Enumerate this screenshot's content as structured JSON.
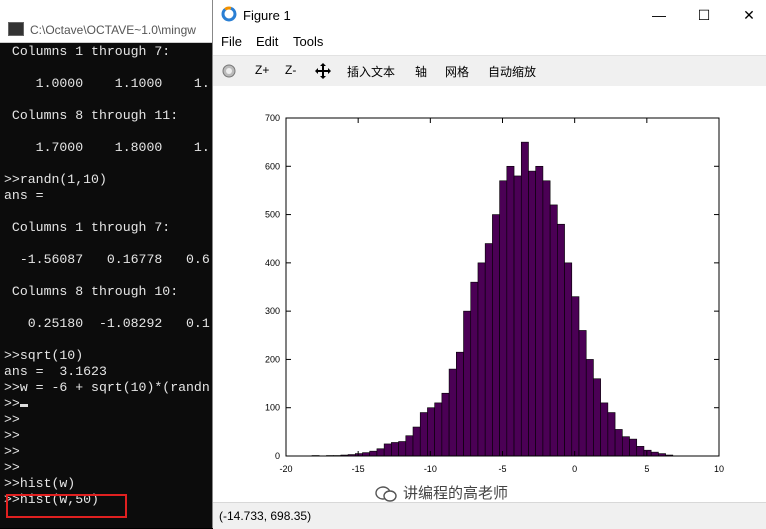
{
  "console": {
    "title": "C:\\Octave\\OCTAVE~1.0\\mingw",
    "lines": [
      " Columns 1 through 7:",
      "",
      "    1.0000    1.1000    1.",
      "",
      " Columns 8 through 11:",
      "",
      "    1.7000    1.8000    1.",
      "",
      ">>randn(1,10)",
      "ans =",
      "",
      " Columns 1 through 7:",
      "",
      "  -1.56087   0.16778   0.6",
      "",
      " Columns 8 through 10:",
      "",
      "   0.25180  -1.08292   0.1",
      "",
      ">>sqrt(10)",
      "ans =  3.1623",
      ">>w = -6 + sqrt(10)*(randn",
      ">>",
      ">>",
      ">>",
      ">>",
      ">>",
      ">>hist(w)",
      ">>hist(w,50)"
    ]
  },
  "figure": {
    "title": "Figure 1",
    "menu": [
      "File",
      "Edit",
      "Tools"
    ],
    "toolbar": {
      "zoom_in": "Z+",
      "zoom_out": "Z-",
      "insert_text": "插入文本",
      "axes": "轴",
      "grid": "网格",
      "autoscale": "自动缩放"
    },
    "window_buttons": {
      "minimize": "—",
      "maximize": "☐",
      "close": "✕"
    },
    "status_coords": "(-14.733, 698.35)"
  },
  "watermark": "讲编程的高老师",
  "chart_data": {
    "type": "bar",
    "title": "",
    "xlabel": "",
    "ylabel": "",
    "xlim": [
      -20,
      10
    ],
    "ylim": [
      0,
      700
    ],
    "xticks": [
      -20,
      -15,
      -10,
      -5,
      0,
      5,
      10
    ],
    "yticks": [
      0,
      100,
      200,
      300,
      400,
      500,
      600,
      700
    ],
    "grid": false,
    "bar_color": "#4b0055",
    "bin_start": -18.2,
    "bin_width": 0.5,
    "values": [
      1,
      0,
      1,
      1,
      2,
      3,
      5,
      7,
      10,
      15,
      25,
      28,
      30,
      42,
      60,
      90,
      100,
      110,
      130,
      180,
      215,
      300,
      360,
      400,
      440,
      500,
      570,
      600,
      580,
      650,
      590,
      600,
      570,
      520,
      480,
      400,
      330,
      260,
      200,
      160,
      110,
      90,
      55,
      40,
      35,
      20,
      12,
      8,
      5,
      2
    ]
  }
}
